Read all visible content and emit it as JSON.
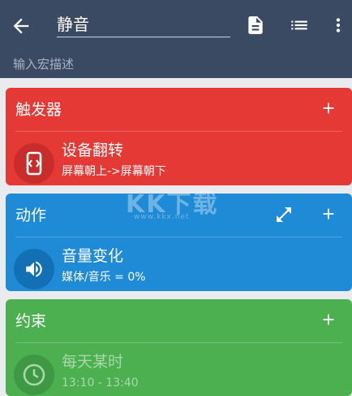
{
  "appbar": {
    "title": "静音",
    "description_placeholder": "输入宏描述",
    "icons": [
      "back-arrow-icon",
      "document-icon",
      "list-icon",
      "more-vert-icon"
    ]
  },
  "trigger": {
    "header": "触发器",
    "item_title": "设备翻转",
    "item_subtitle": "屏幕朝上->屏幕朝下",
    "icon": "phone-flip-icon",
    "color": "#e53935"
  },
  "action": {
    "header": "动作",
    "item_title": "音量变化",
    "item_subtitle": "媒体/音乐 = 0%",
    "icon": "volume-icon",
    "color": "#1f8ad6"
  },
  "constraint": {
    "header": "约束",
    "item_title": "每天某时",
    "item_subtitle": "13:10 - 13:40",
    "icon": "clock-icon",
    "color": "#4caf50"
  },
  "watermark": {
    "text": "KK下载",
    "subtext": "www.kkx.net"
  }
}
